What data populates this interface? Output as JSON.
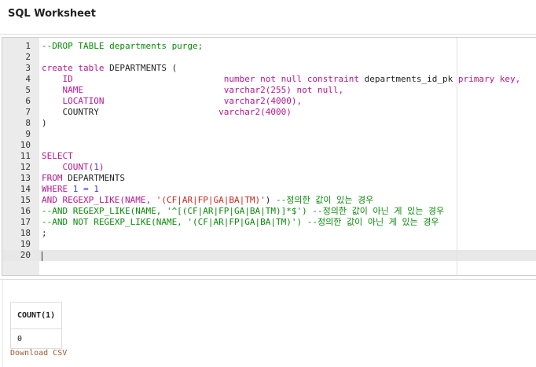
{
  "title": "SQL Worksheet",
  "colors": {
    "k": "#b5178f",
    "c": "#0a8a0a",
    "s": "#d0261c",
    "n": "#3b3bd6",
    "d": "#222222"
  },
  "editor": {
    "lines": [
      [
        {
          "t": "--DROP TABLE departments purge;",
          "c": "c"
        }
      ],
      [],
      [
        {
          "t": "create table ",
          "c": "k"
        },
        {
          "t": "DEPARTMENTS (",
          "c": "d"
        }
      ],
      [
        {
          "t": "    ID                             ",
          "c": "k"
        },
        {
          "t": "number not null constraint ",
          "c": "k"
        },
        {
          "t": "departments_id_pk ",
          "c": "d"
        },
        {
          "t": "primary key,",
          "c": "k"
        }
      ],
      [
        {
          "t": "    NAME                           ",
          "c": "k"
        },
        {
          "t": "varchar2(255) not null,",
          "c": "k"
        }
      ],
      [
        {
          "t": "    LOCATION                       ",
          "c": "k"
        },
        {
          "t": "varchar2(4000),",
          "c": "k"
        }
      ],
      [
        {
          "t": "    COUNTRY                       ",
          "c": "d"
        },
        {
          "t": "varchar2(4000)",
          "c": "k"
        }
      ],
      [
        {
          "t": ")",
          "c": "d"
        }
      ],
      [],
      [],
      [
        {
          "t": "SELECT",
          "c": "k"
        }
      ],
      [
        {
          "t": "    COUNT(",
          "c": "k"
        },
        {
          "t": "1",
          "c": "n"
        },
        {
          "t": ")",
          "c": "k"
        }
      ],
      [
        {
          "t": "FROM ",
          "c": "k"
        },
        {
          "t": "DEPARTMENTS",
          "c": "d"
        }
      ],
      [
        {
          "t": "WHERE ",
          "c": "k"
        },
        {
          "t": "1 = 1",
          "c": "n"
        }
      ],
      [
        {
          "t": "AND REGEXP_LIKE(NAME, ",
          "c": "k"
        },
        {
          "t": "'(CF|AR|FP|GA|BA|TM)'",
          "c": "s"
        },
        {
          "t": ") ",
          "c": "d"
        },
        {
          "t": "--정의한 값이 있는 경우",
          "c": "c"
        }
      ],
      [
        {
          "t": "--AND REGEXP_LIKE(NAME, '^[(CF|AR|FP|GA|BA|TM)]*$') --정의한 값이 아닌 게 있는 경우",
          "c": "c"
        }
      ],
      [
        {
          "t": "--AND NOT REGEXP_LIKE(NAME, '(CF|AR|FP|GA|BA|TM)') --정의한 값이 아닌 게 있는 경우",
          "c": "c"
        }
      ],
      [
        {
          "t": ";",
          "c": "d"
        }
      ],
      [],
      []
    ]
  },
  "results": {
    "header": "COUNT(1)",
    "value": "0",
    "download": "Download CSV"
  }
}
